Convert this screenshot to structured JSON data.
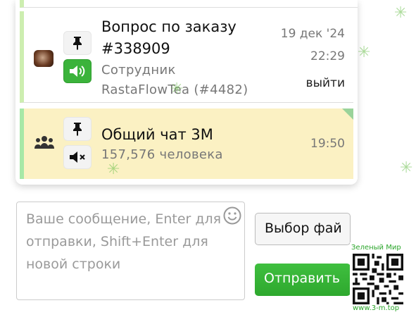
{
  "chats": [
    {
      "title_line1": "Вопрос по заказу",
      "title_line2": "#338909",
      "subtitle_line1": "Сотрудник",
      "subtitle_line2": "RastaFlowTea (#4482)",
      "date": "19 дек '24",
      "time": "22:29",
      "action": "выйти",
      "pin_icon": "pin-icon",
      "sound_icon": "speaker-on-icon"
    },
    {
      "title": "Общий чат 3М",
      "subtitle": "157,576 человека",
      "time": "19:50",
      "pin_icon": "pin-icon",
      "sound_icon": "speaker-muted-icon",
      "avatar_icon": "group-icon"
    }
  ],
  "composer": {
    "placeholder": "Ваше сообщение, Enter для отправки, Shift+Enter для новой строки",
    "emoji_icon": "smiley-icon",
    "file_button": "Выбор фай",
    "send_button": "Отправить"
  },
  "watermark": {
    "top_text": "Зеленый Мир",
    "bottom_text": "www.3-m.top"
  },
  "colors": {
    "accent_green": "#3bb33b",
    "row_highlight": "#fbf1c3",
    "row_border": "#cdeeb0"
  }
}
